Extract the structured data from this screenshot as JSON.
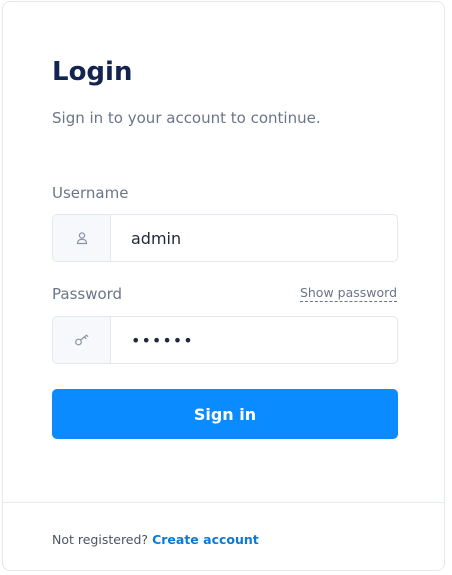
{
  "header": {
    "title": "Login",
    "subtitle": "Sign in to your account to continue."
  },
  "form": {
    "username": {
      "label": "Username",
      "value": "admin",
      "icon": "user-icon"
    },
    "password": {
      "label": "Password",
      "value": "••••••",
      "show_password_label": "Show password",
      "icon": "key-icon"
    },
    "submit_label": "Sign in"
  },
  "footer": {
    "prompt": "Not registered?",
    "link_label": "Create account"
  },
  "colors": {
    "primary": "#0a8bff",
    "title": "#13244f",
    "link": "#0a7ad6"
  }
}
